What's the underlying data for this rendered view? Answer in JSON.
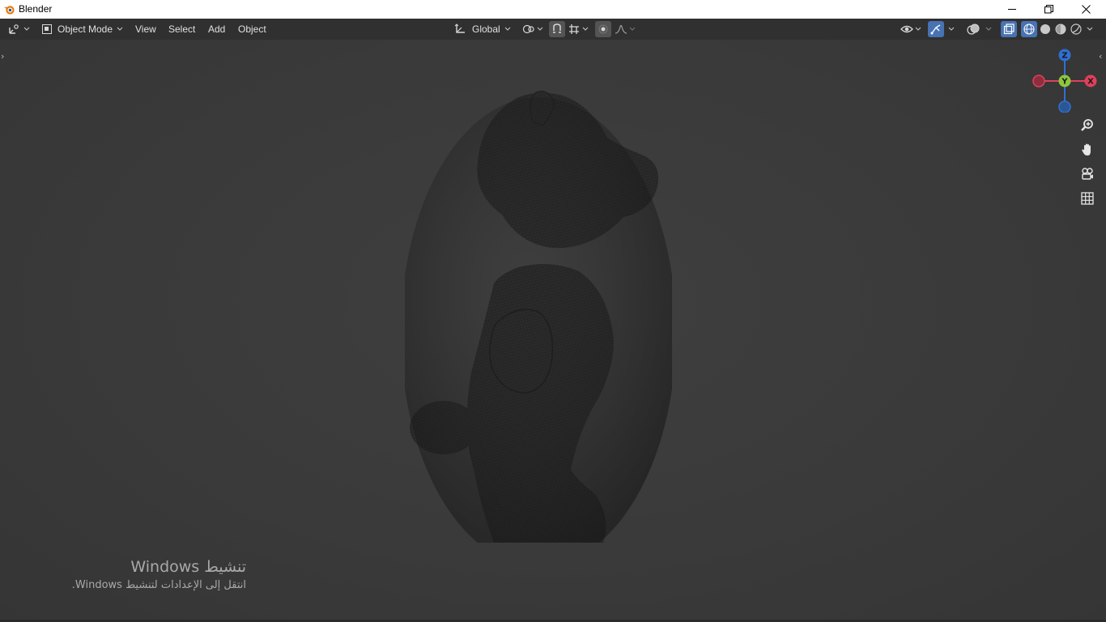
{
  "window": {
    "title": "Blender",
    "controls": [
      "minimize-icon",
      "restore-icon",
      "close-icon"
    ]
  },
  "header": {
    "editor_type_icon": "3d-viewport-icon",
    "mode": "Object Mode",
    "menus": [
      "View",
      "Select",
      "Add",
      "Object"
    ],
    "transform_orientation": "Global",
    "pivot_icon": "pivot-point-icon",
    "snap_icon": "snap-icon",
    "snap_target_icon": "snap-increment-icon",
    "proportional_icon": "proportional-editing-icon",
    "falloff_icon": "falloff-curve-icon",
    "visibility_icon": "eye-icon",
    "gizmo_toggle_icon": "gizmo-icon",
    "overlay_icon": "overlay-icon",
    "xray_icon": "xray-icon",
    "shading_modes": [
      "wireframe",
      "solid",
      "material-preview",
      "rendered"
    ],
    "active_shading": "solid",
    "accent_color": "#4772b3"
  },
  "viewport": {
    "gizmo": {
      "z_label": "Z",
      "y_label": "Y",
      "x_label": "X",
      "z_color": "#2f6fd3",
      "y_color": "#8cc63f",
      "x_color": "#e0405a"
    },
    "nav_tools": [
      "zoom-icon",
      "hand-pan-icon",
      "camera-icon",
      "grid-ortho-icon"
    ],
    "object": "teddy-bear-mesh"
  },
  "watermark": {
    "title": "تنشيط Windows",
    "subtitle": "انتقل إلى الإعدادات لتنشيط Windows."
  }
}
